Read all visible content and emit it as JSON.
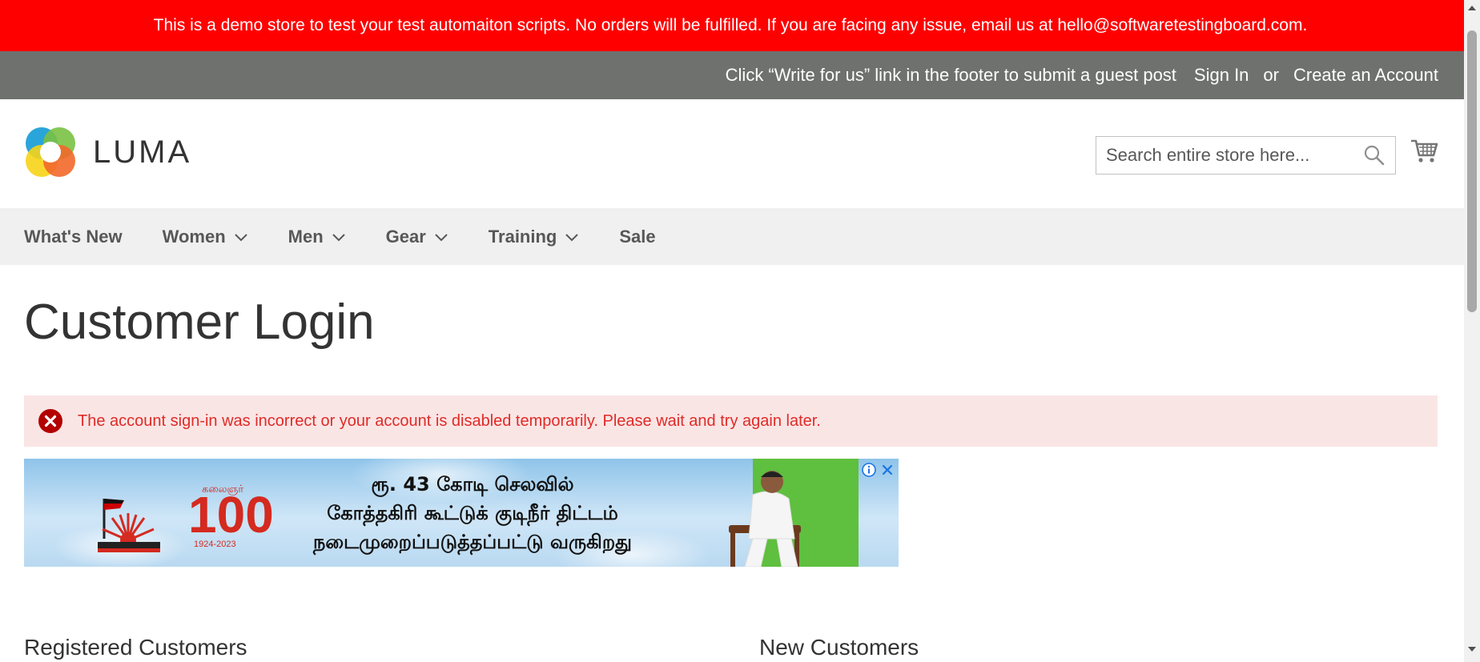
{
  "demo_banner": {
    "text": "This is a demo store to test your test automaiton scripts. No orders will be fulfilled. If you are facing any issue, email us at hello@softwaretestingboard.com."
  },
  "panel_header": {
    "guest_post_text": "Click “Write for us” link in the footer to submit a guest post",
    "sign_in": "Sign In",
    "or": "or",
    "create_account": "Create an Account"
  },
  "header": {
    "logo_text": "LUMA",
    "search_placeholder": "Search entire store here..."
  },
  "nav": {
    "items": [
      {
        "label": "What's New"
      },
      {
        "label": "Women"
      },
      {
        "label": "Men"
      },
      {
        "label": "Gear"
      },
      {
        "label": "Training"
      },
      {
        "label": "Sale"
      }
    ]
  },
  "page": {
    "title": "Customer Login",
    "error_message": "The account sign-in was incorrect or your account is disabled temporarily. Please wait and try again later.",
    "registered_title": "Registered Customers",
    "new_title": "New Customers"
  },
  "ad": {
    "kalaignar": "கலைஞர்",
    "hundred": "100",
    "years": "1924-2023",
    "line1": "ரூ. 43 கோடி செலவில்",
    "line2": "கோத்தகிரி கூட்டுக் குடிநீர் திட்டம்",
    "line3": "நடைமுறைப்படுத்தப்பட்டு வருகிறது"
  },
  "colors": {
    "demo_banner_bg": "#ff0000",
    "panel_header_bg": "#6e716e",
    "nav_bg": "#f0f0f0",
    "error_bg": "#fae5e5",
    "error_text": "#e02b27"
  }
}
